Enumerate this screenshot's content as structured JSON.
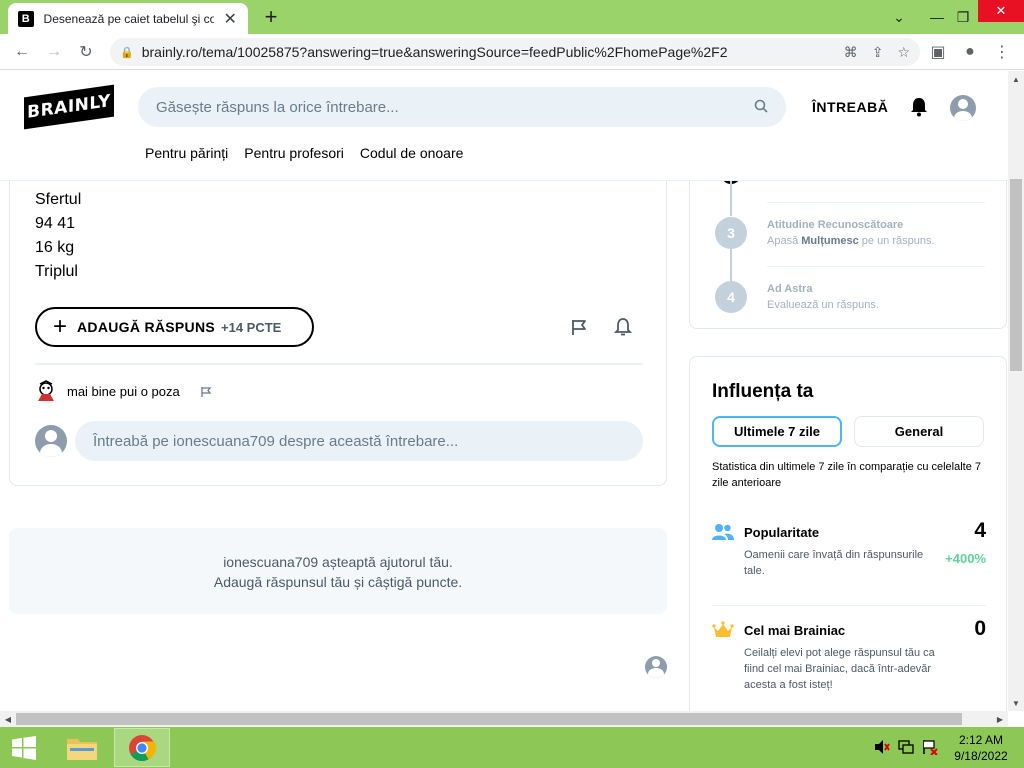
{
  "browser": {
    "tab_title": "Desenează pe caiet tabelul şi completează",
    "tab_favicon": "B",
    "url": "brainly.ro/tema/10025875?answering=true&answeringSource=feedPublic%2FhomePage%2F2"
  },
  "header": {
    "logo": "BRAINLY",
    "search_placeholder": "Găsește răspuns la orice întrebare...",
    "ask_label": "ÎNTREABĂ",
    "subnav": [
      "Pentru părinți",
      "Pentru profesori",
      "Codul de onoare"
    ]
  },
  "answer": {
    "lines": [
      "Sfertul",
      "94 41",
      "16 kg",
      "Triplul"
    ],
    "add_answer_label": "ADAUGĂ RĂSPUNS",
    "add_answer_points": "+14 PCTE"
  },
  "comment": {
    "text": "mai bine pui o poza"
  },
  "ask_question_placeholder": "Întreabă pe ionescuana709 despre această întrebare...",
  "waiting": {
    "line1": "ionescuana709 așteaptă ajutorul tău.",
    "line2": "Adaugă răspunsul tău și câștigă puncte."
  },
  "steps": [
    {
      "num": "3",
      "title": "Atitudine Recunoscătoare",
      "desc_pre": "Apasă ",
      "desc_bold": "Mulțumesc",
      "desc_post": " pe un răspuns."
    },
    {
      "num": "4",
      "title": "Ad Astra",
      "desc_pre": "Evaluează un răspuns.",
      "desc_bold": "",
      "desc_post": ""
    }
  ],
  "influence": {
    "title": "Influența ta",
    "tab_active": "Ultimele 7 zile",
    "tab_inactive": "General",
    "description": "Statistica din ultimele 7 zile în comparație cu celelalte 7 zile anterioare",
    "metrics": [
      {
        "icon": "people-icon",
        "title": "Popularitate",
        "value": "4",
        "desc": "Oamenii care învață din răspunsurile tale.",
        "delta": "+400%"
      },
      {
        "icon": "crown-icon",
        "title": "Cel mai Brainiac",
        "value": "0",
        "desc": "Ceilalți elevi pot alege răspunsul tău ca fiind cel mai Brainiac, dacă într-adevăr acesta a fost isteț!",
        "delta": ""
      }
    ]
  },
  "taskbar": {
    "time": "2:12 AM",
    "date": "9/18/2022"
  },
  "colors": {
    "tabstrip": "#9bd36b",
    "taskbar": "#8dc857",
    "accent_blue": "#4fb3f6",
    "delta_green": "#60d399",
    "search_bg": "#ebf2f7"
  }
}
